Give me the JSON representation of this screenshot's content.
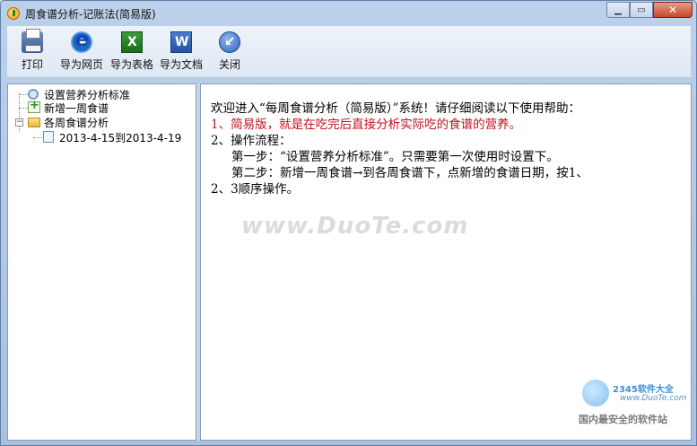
{
  "window": {
    "title": "周食谱分析-记账法(简易版)"
  },
  "toolbar": {
    "buttons": [
      {
        "label": "打印",
        "icon": "printer-icon"
      },
      {
        "label": "导为网页",
        "icon": "ie-icon"
      },
      {
        "label": "导为表格",
        "icon": "excel-icon"
      },
      {
        "label": "导为文档",
        "icon": "word-icon"
      },
      {
        "label": "关闭",
        "icon": "close-circle-icon"
      }
    ]
  },
  "tree": {
    "items": [
      {
        "label": "设置营养分析标准"
      },
      {
        "label": "新增一周食谱"
      },
      {
        "label": "各周食谱分析"
      },
      {
        "label": "2013-4-15到2013-4-19"
      }
    ]
  },
  "content": {
    "line1": "欢迎进入“每周食谱分析（简易版）”系统！请仔细阅读以下使用帮助：",
    "line2": "1、简易版，就是在吃完后直接分析实际吃的食谱的营养。",
    "line3": "2、操作流程：",
    "line4": "第一步：“设置营养分析标准”。只需要第一次使用时设置下。",
    "line5": "第二步：新增一周食谱→到各周食谱下，点新增的食谱日期，按1、",
    "line6": "2、3顺序操作。"
  },
  "watermark": {
    "text": "www.DuoTe.com"
  },
  "badge": {
    "brand": "2345软件大全",
    "site": "www.DuoTe.com",
    "slogan": "国内最安全的软件站"
  },
  "colors": {
    "highlight_red": "#c1121f"
  }
}
